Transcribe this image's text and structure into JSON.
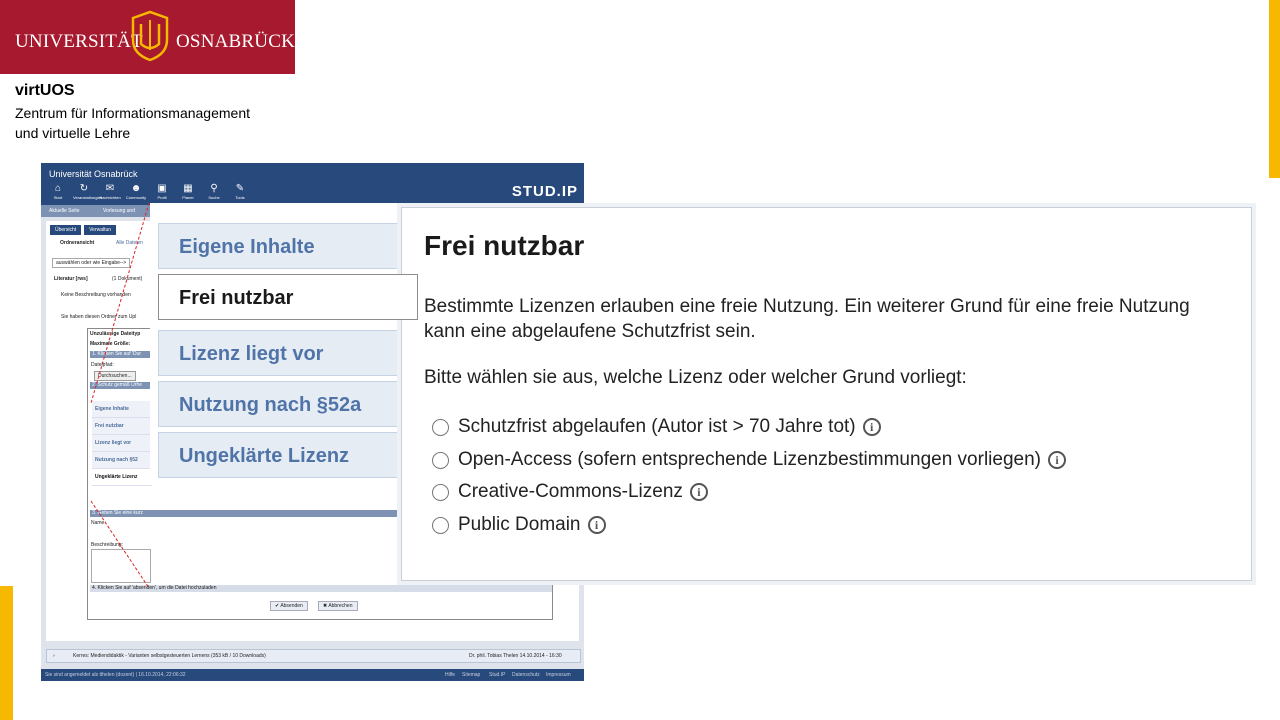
{
  "header": {
    "logo_left": "UNIVERSITÄT",
    "logo_right": "OSNABRÜCK",
    "org_name": "virtUOS",
    "org_sub_line1": "Zentrum für Informationsmanagement",
    "org_sub_line2": "und virtuelle Lehre"
  },
  "studip": {
    "university": "Universität Osnabrück",
    "brand": "STUD.IP",
    "nav": [
      "Start",
      "Veranstaltungen",
      "Nachrichten",
      "Community",
      "Profil",
      "Planer",
      "Suche",
      "Tools"
    ],
    "crumb_current": "Aktuelle Seite",
    "crumb_course": "Vorlesung und",
    "tab_overview": "Übersicht",
    "tab_admin": "Verwaltun",
    "folder_view": "Ordneransicht",
    "all_files": "Alle Dateien",
    "select_hint": "auswählen oder wie Eingabe-->",
    "folder_name": "Literatur [rws]",
    "folder_count": "(1 Dokument)",
    "no_desc": "Keine Beschreibung vorhanden",
    "upload_hint": "Sie haben diesen Ordner zum Upl",
    "invalid_types": "Unzulässige Dateityp",
    "max_size": "Maximale Größe:",
    "step1": "1. Klicken Sie auf 'Dur",
    "file_path": "Dateipfad:",
    "browse": "Durchsuchen...",
    "step2": "2. Schutz gemäß Urhe",
    "mini_list": [
      "Eigene Inhalte",
      "Frei nutzbar",
      "Lizenz liegt vor",
      "Nutzung nach §52",
      "Ungeklärte Lizenz"
    ],
    "step3": "3. Geben Sie eine kurz",
    "name_label": "Name",
    "desc_label": "Beschreibung:",
    "step4": "4. Klicken Sie auf 'absenden', um die Datei hochzuladen",
    "btn_send": "Absenden",
    "btn_cancel": "Abbrechen",
    "file_row": "Kerres: Mediendidaktik - Varianten selbstgesteuerten Lernens  (353 kB / 10 Downloads)",
    "file_author": "Dr. phil. Tobias Thelen 14.10.2014 - 16:30",
    "footer_left": "Sie sind angemeldet als tthelen (dozent) | 16.10.2014, 22:06:32",
    "footer_links": [
      "Hilfe",
      "Sitemap",
      "Stud.IP",
      "Datenschutz",
      "Impressum"
    ]
  },
  "license_tabs": [
    "Eigene Inhalte",
    "Frei nutzbar",
    "Lizenz liegt vor",
    "Nutzung nach §52a",
    "Ungeklärte Lizenz"
  ],
  "license_active_index": 1,
  "panel": {
    "heading": "Frei nutzbar",
    "intro": "Bestimmte Lizenzen erlauben eine freie Nutzung. Ein weiterer Grund für eine freie Nutzung kann eine abgelaufene Schutzfrist sein.",
    "question": "Bitte wählen sie aus, welche Lizenz oder welcher Grund vorliegt:",
    "options": [
      "Schutzfrist abgelaufen (Autor ist > 70 Jahre tot)",
      "Open-Access (sofern entsprechende Lizenzbestimmungen vorliegen)",
      "Creative-Commons-Lizenz",
      "Public Domain"
    ]
  },
  "colors": {
    "brand_red": "#a6192e",
    "accent_yellow": "#f6b800",
    "studip_blue": "#28497c",
    "tab_blue_text": "#5074a8"
  }
}
